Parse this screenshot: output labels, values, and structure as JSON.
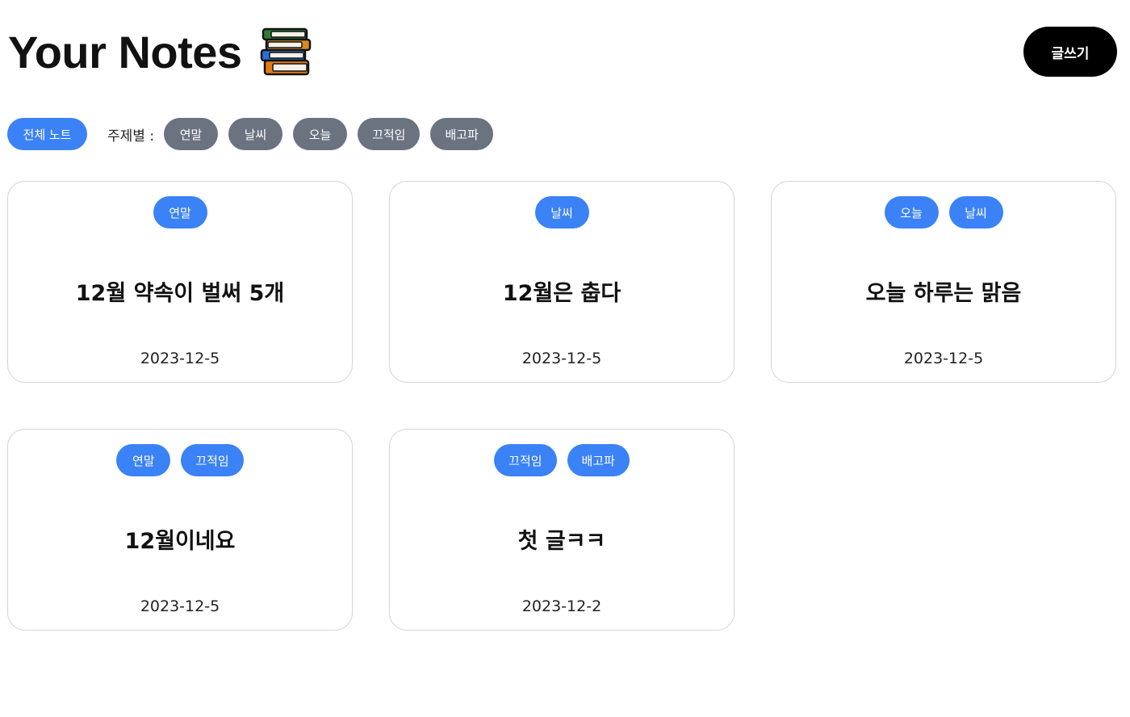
{
  "header": {
    "title": "Your Notes",
    "write_button": "글쓰기"
  },
  "filters": {
    "all_label": "전체 노트",
    "topic_label": "주제별 :",
    "topics": [
      "연말",
      "날씨",
      "오늘",
      "끄적임",
      "배고파"
    ]
  },
  "notes": [
    {
      "tags": [
        "연말"
      ],
      "title": "12월 약속이 벌써 5개",
      "date": "2023-12-5"
    },
    {
      "tags": [
        "날씨"
      ],
      "title": "12월은 춥다",
      "date": "2023-12-5"
    },
    {
      "tags": [
        "오늘",
        "날씨"
      ],
      "title": "오늘 하루는 맑음",
      "date": "2023-12-5"
    },
    {
      "tags": [
        "연말",
        "끄적임"
      ],
      "title": "12월이네요",
      "date": "2023-12-5"
    },
    {
      "tags": [
        "끄적임",
        "배고파"
      ],
      "title": "첫 글ㅋㅋ",
      "date": "2023-12-2"
    }
  ],
  "colors": {
    "accent": "#3b82f6",
    "topic_pill": "#6b7280",
    "write_button": "#000000"
  },
  "icons": {
    "title_icon": "books-icon"
  }
}
